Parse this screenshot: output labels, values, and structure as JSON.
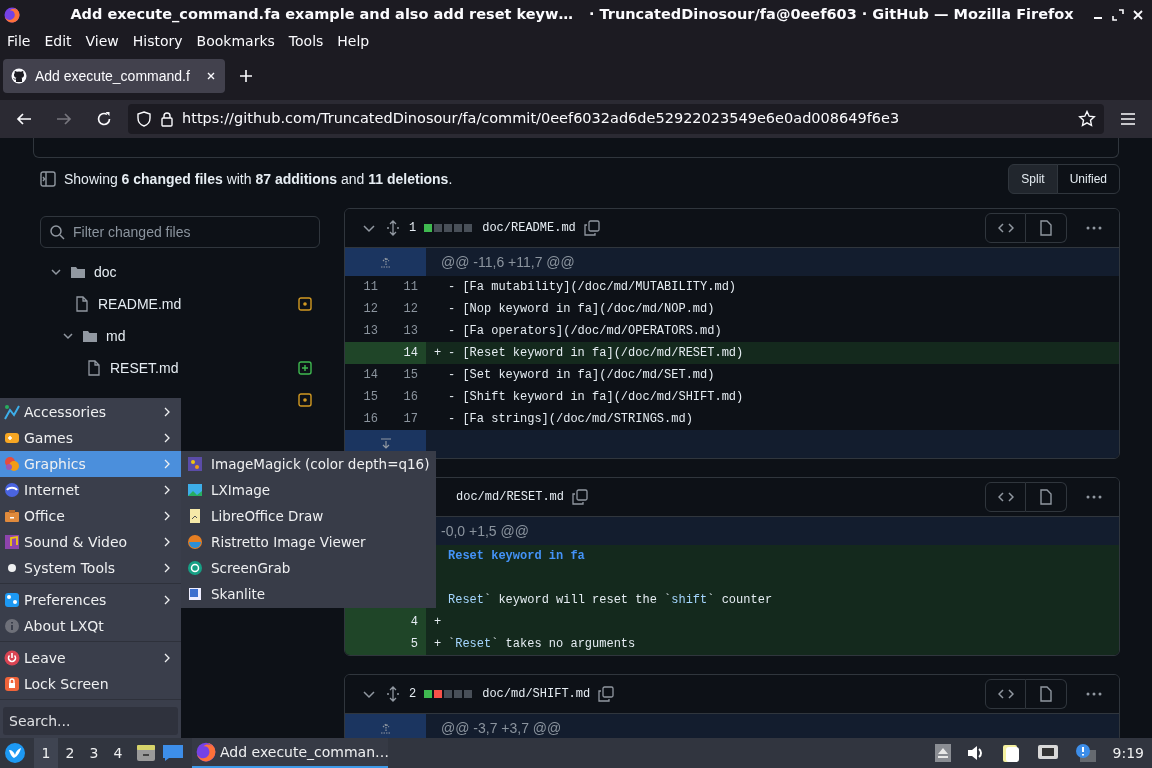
{
  "window": {
    "title_parts": [
      "Add execute_command.fa example and also add reset keyw…",
      "· TruncatedDinosour/fa@0eef603 · GitHub — Mozilla Firefox"
    ]
  },
  "menu_bar": [
    "File",
    "Edit",
    "View",
    "History",
    "Bookmarks",
    "Tools",
    "Help"
  ],
  "tabs": [
    {
      "label": "Add execute_command.f",
      "selected": true
    }
  ],
  "address_bar": {
    "url": "https://github.com/TruncatedDinosour/fa/commit/0eef6032ad6de52922023549e6e0ad008649f6e3"
  },
  "summary": "Showing **6 changed files** with **87 additions** and **11 deletions**.",
  "view_toggle": [
    {
      "label": "Split",
      "selected": true
    },
    {
      "label": "Unified",
      "selected": false
    }
  ],
  "file_filter": {
    "placeholder": "Filter changed files"
  },
  "file_tree": [
    {
      "kind": "folder",
      "name": "doc",
      "expanded": true,
      "children": [
        {
          "kind": "modified",
          "name": "README.md"
        },
        {
          "kind": "folder",
          "name": "md",
          "expanded": true,
          "children": [
            {
              "kind": "added",
              "name": "RESET.md"
            },
            {
              "kind": "modified"
            }
          ]
        }
      ]
    }
  ],
  "diffs": [
    {
      "index": "1",
      "stat": [
        {
          "color": "#3fb950"
        },
        {
          "color": "#484f58"
        },
        {
          "color": "#484f58"
        },
        {
          "color": "#484f58"
        },
        {
          "color": "#484f58"
        }
      ],
      "path": "doc/README.md",
      "lines": [
        {
          "kind": "hunk",
          "text": "@@ -11,6 +11,7 @@"
        },
        {
          "kind": "context",
          "old": "11",
          "new": "11",
          "code": "- [Fa mutability](/doc/md/MUTABILITY.md)"
        },
        {
          "kind": "context",
          "old": "12",
          "new": "12",
          "code": "- [Nop keyword in fa](/doc/md/NOP.md)"
        },
        {
          "kind": "context",
          "old": "13",
          "new": "13",
          "code": "- [Fa operators](/doc/md/OPERATORS.md)"
        },
        {
          "kind": "added",
          "new": "14",
          "sign": "+",
          "code": "- [Reset keyword in fa](/doc/md/RESET.md)"
        },
        {
          "kind": "context",
          "old": "14",
          "new": "15",
          "code": "- [Set keyword in fa](/doc/md/SET.md)"
        },
        {
          "kind": "context",
          "old": "15",
          "new": "16",
          "code": "- [Shift keyword in fa](/doc/md/SHIFT.md)"
        },
        {
          "kind": "context",
          "old": "16",
          "new": "17",
          "code": "- [Fa strings](/doc/md/STRINGS.md)"
        },
        {
          "kind": "expand"
        }
      ]
    },
    {
      "path": "doc/md/RESET.md",
      "lines": [
        {
          "kind": "hunk",
          "text": "-0,0 +1,5 @@"
        },
        {
          "kind": "added",
          "segments": [
            {
              "text": "Reset keyword in fa",
              "kind": "heading"
            }
          ]
        },
        {
          "kind": "added"
        },
        {
          "kind": "added",
          "segments": [
            {
              "text": "Reset",
              "kind": "code"
            },
            {
              "text": "` keyword will reset the `",
              "kind": "plain"
            },
            {
              "text": "shift",
              "kind": "code"
            },
            {
              "text": "` counter",
              "kind": "plain"
            }
          ]
        },
        {
          "kind": "added",
          "new": "4",
          "sign": "+"
        },
        {
          "kind": "added",
          "new": "5",
          "sign": "+",
          "segments": [
            {
              "text": "`",
              "kind": "plain"
            },
            {
              "text": "Reset",
              "kind": "code"
            },
            {
              "text": "` takes no arguments",
              "kind": "plain"
            }
          ]
        }
      ]
    },
    {
      "index": "2",
      "stat": [
        {
          "color": "#3fb950"
        },
        {
          "color": "#f85149"
        },
        {
          "color": "#484f58"
        },
        {
          "color": "#484f58"
        },
        {
          "color": "#484f58"
        }
      ],
      "path": "doc/md/SHIFT.md",
      "lines": [
        {
          "kind": "hunk",
          "text": "@@ -3,7 +3,7 @@"
        }
      ]
    }
  ],
  "start_menu": {
    "groups": [
      [
        {
          "label": "Accessories",
          "submenu": true,
          "selected": false
        },
        {
          "label": "Games",
          "submenu": true,
          "selected": false
        },
        {
          "label": "Graphics",
          "submenu": true,
          "selected": true
        },
        {
          "label": "Internet",
          "submenu": true,
          "selected": false
        },
        {
          "label": "Office",
          "submenu": true,
          "selected": false
        },
        {
          "label": "Sound & Video",
          "submenu": true,
          "selected": false
        },
        {
          "label": "System Tools",
          "submenu": true,
          "selected": false
        }
      ],
      [
        {
          "label": "Preferences",
          "submenu": true,
          "selected": false
        },
        {
          "label": "About LXQt",
          "submenu": false,
          "selected": false
        }
      ],
      [
        {
          "label": "Leave",
          "submenu": true,
          "selected": false
        },
        {
          "label": "Lock Screen",
          "submenu": false,
          "selected": false
        }
      ]
    ],
    "search": {
      "placeholder": "Search..."
    }
  },
  "submenu": {
    "items": [
      "ImageMagick (color depth=q16)",
      "LXImage",
      "LibreOffice Draw",
      "Ristretto Image Viewer",
      "ScreenGrab",
      "Skanlite"
    ]
  },
  "taskbar": {
    "desktops": [
      {
        "label": "1",
        "selected": true
      },
      {
        "label": "2",
        "selected": false
      },
      {
        "label": "3",
        "selected": false
      },
      {
        "label": "4",
        "selected": false
      }
    ],
    "task": {
      "label": "Add execute_comman…",
      "selected": true
    },
    "clock": "9:19"
  }
}
